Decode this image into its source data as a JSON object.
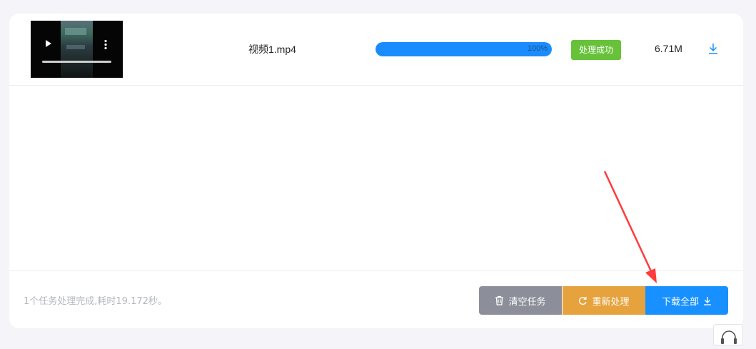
{
  "file": {
    "name": "视频1.mp4",
    "progress_text": "100%",
    "progress_value": 1.0,
    "status": "处理成功",
    "size": "6.71M"
  },
  "summary": "1个任务处理完成,耗时19.172秒。",
  "actions": {
    "clear": "清空任务",
    "redo": "重新处理",
    "download_all": "下载全部"
  },
  "icons": {
    "play": "play-icon",
    "more": "more-vertical-icon",
    "download": "download-icon",
    "trash": "trash-icon",
    "refresh": "refresh-icon",
    "headset": "headset-icon"
  },
  "colors": {
    "progress": "#1a8cff",
    "success": "#67c23a",
    "clear_button": "#8c8f99",
    "redo_button": "#e6a23c",
    "download_button": "#1890ff",
    "annotation_arrow": "#ff3b3b"
  }
}
